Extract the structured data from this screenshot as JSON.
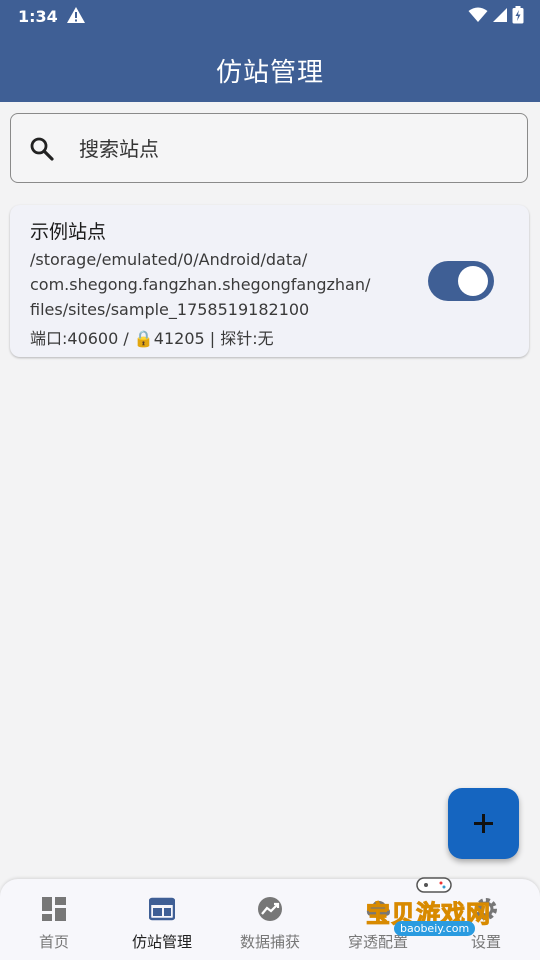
{
  "status_bar": {
    "time": "1:34"
  },
  "header": {
    "title": "仿站管理"
  },
  "search": {
    "placeholder": "搜索站点"
  },
  "sites": [
    {
      "name": "示例站点",
      "path_lines": [
        "/storage/emulated/0/Android/data/",
        "com.shegong.fangzhan.shegongfangzhan/",
        "files/sites/sample_1758519182100"
      ],
      "ports": "端口:40600 / 🔒41205 | 探针:无",
      "enabled": true
    }
  ],
  "bottom_nav": {
    "items": [
      {
        "label": "首页",
        "icon": "dashboard-icon"
      },
      {
        "label": "仿站管理",
        "icon": "web-icon"
      },
      {
        "label": "数据捕获",
        "icon": "trending-icon"
      },
      {
        "label": "穿透配置",
        "icon": "cloud-icon"
      },
      {
        "label": "设置",
        "icon": "settings-icon"
      }
    ],
    "active_index": 1
  },
  "watermark": {
    "text": "宝贝游戏网",
    "url": "baobeiy.com"
  },
  "colors": {
    "primary": "#3f5f95",
    "fab": "#1565c0",
    "background": "#f3f3f4"
  }
}
